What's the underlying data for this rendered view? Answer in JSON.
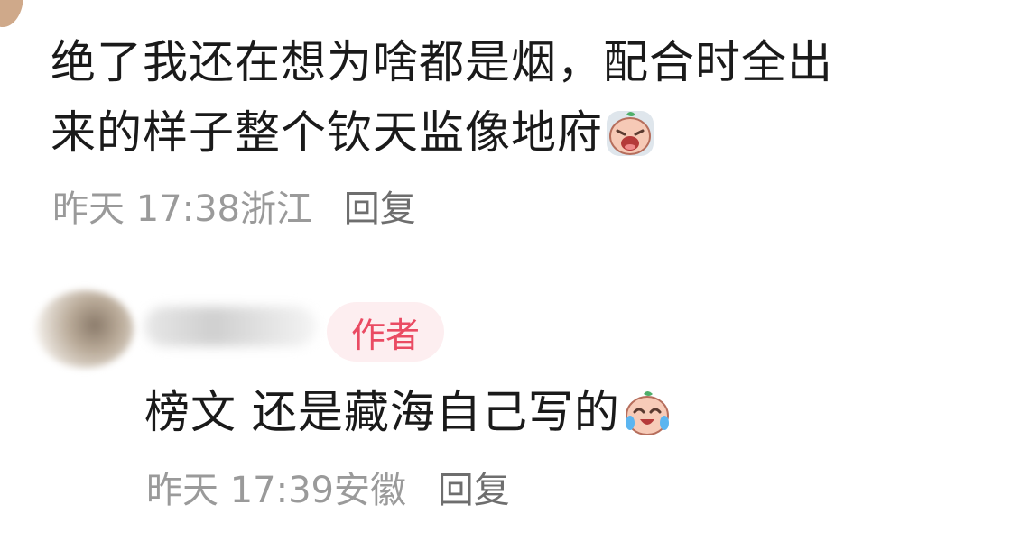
{
  "comments": [
    {
      "text_line1": "绝了我还在想为啥都是烟，配合时全出",
      "text_line2": "来的样子整个钦天监像地府",
      "emoji_icon": "crying-face-icon",
      "date": "昨天",
      "time": "17:38",
      "location": "浙江",
      "reply_label": "回复"
    },
    {
      "badge": "作者",
      "text": "榜文 还是藏海自己写的",
      "emoji_icon": "laughing-tears-face-icon",
      "date": "昨天",
      "time": "17:39",
      "location": "安徽",
      "reply_label": "回复"
    }
  ],
  "colors": {
    "text": "#1a1a1a",
    "meta": "#9a9a9a",
    "badge_text": "#ea4b63",
    "badge_bg": "#fdeef0"
  }
}
